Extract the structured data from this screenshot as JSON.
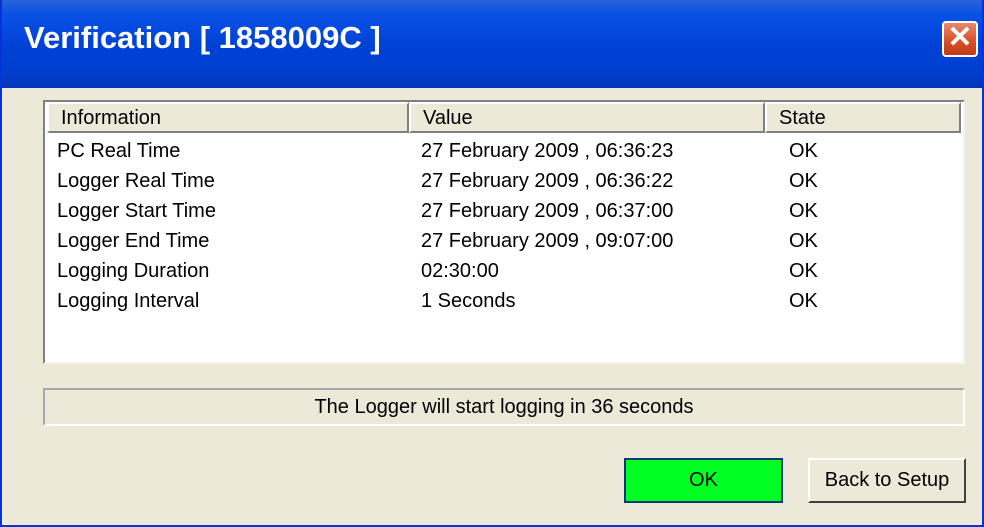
{
  "window": {
    "title": "Verification [ 1858009C ]",
    "close_label": "✕"
  },
  "table": {
    "headers": {
      "information": "Information",
      "value": "Value",
      "state": "State"
    },
    "rows": [
      {
        "information": "PC Real Time",
        "value": "27 February 2009 , 06:36:23",
        "state": "OK"
      },
      {
        "information": "Logger Real Time",
        "value": "27 February 2009 , 06:36:22",
        "state": "OK"
      },
      {
        "information": "Logger Start Time",
        "value": "27 February 2009 , 06:37:00",
        "state": "OK"
      },
      {
        "information": "Logger End Time",
        "value": "27 February 2009 , 09:07:00",
        "state": "OK"
      },
      {
        "information": "Logging Duration",
        "value": "02:30:00",
        "state": "OK"
      },
      {
        "information": "Logging Interval",
        "value": "1 Seconds",
        "state": "OK"
      }
    ]
  },
  "status_text": "The Logger will start logging in 36 seconds",
  "buttons": {
    "ok": "OK",
    "back": "Back to Setup"
  },
  "colors": {
    "titlebar": "#0042d6",
    "ok_button": "#00ff22",
    "close_button": "#d8512b",
    "dialog_bg": "#ece9d8"
  }
}
